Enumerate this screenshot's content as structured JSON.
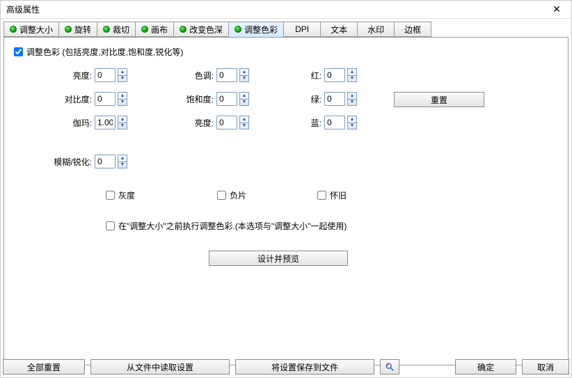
{
  "window": {
    "title": "高级属性"
  },
  "tabs": {
    "t0": "调整大小",
    "t1": "旋转",
    "t2": "裁切",
    "t3": "画布",
    "t4": "改变色深",
    "t5": "调整色彩",
    "t6": "DPI",
    "t7": "文本",
    "t8": "水印",
    "t9": "边框"
  },
  "panel": {
    "enable_label": "调整色彩 (包括亮度,对比度,饱和度,锐化等)",
    "brightness_label": "亮度:",
    "contrast_label": "对比度:",
    "gamma_label": "伽玛:",
    "hue_label": "色调:",
    "saturation_label": "饱和度:",
    "brightness2_label": "亮度:",
    "red_label": "红:",
    "green_label": "绿:",
    "blue_label": "蓝:",
    "blurSharpen_label": "模糊/锐化:",
    "grayscale_label": "灰度",
    "negative_label": "负片",
    "sepia_label": "怀旧",
    "beforeResize_label": "在\"调整大小\"之前执行调整色彩.(本选项与\"调整大小\"一起使用)",
    "reset_btn": "重置",
    "preview_btn": "设计并预览"
  },
  "values": {
    "brightness": "0",
    "contrast": "0",
    "gamma": "1.00",
    "hue": "0",
    "saturation": "0",
    "brightness2": "0",
    "red": "0",
    "green": "0",
    "blue": "0",
    "blurSharpen": "0"
  },
  "footer": {
    "reset_all": "全部重置",
    "load": "从文件中读取设置",
    "save": "将设置保存到文件",
    "ok": "确定",
    "cancel": "取消"
  }
}
